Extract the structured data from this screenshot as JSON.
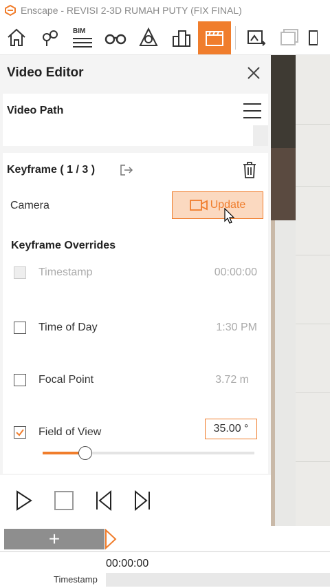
{
  "window": {
    "title": "Enscape - REVISI 2-3D RUMAH PUTY (FIX FINAL)"
  },
  "toolbar": {
    "bim_label": "BIM",
    "icons": [
      "home-icon",
      "location-pin-icon",
      "bim-icon",
      "binoculars-icon",
      "perspective-icon",
      "buildings-icon",
      "clapperboard-icon",
      "export-image-icon",
      "batch-export-icon",
      "export-icon"
    ]
  },
  "panel": {
    "title": "Video Editor",
    "video_path": {
      "title": "Video Path"
    },
    "keyframe": {
      "title": "Keyframe ( 1 / 3 )",
      "camera_label": "Camera",
      "update_label": "Update",
      "overrides_title": "Keyframe Overrides",
      "overrides": [
        {
          "label": "Timestamp",
          "value": "00:00:00",
          "checked": false,
          "disabled": true
        },
        {
          "label": "Time of Day",
          "value": "1:30 PM",
          "checked": false,
          "disabled": false
        },
        {
          "label": "Focal Point",
          "value": "3.72  m",
          "checked": false,
          "disabled": false
        },
        {
          "label": "Field of View",
          "value": "35.00  °",
          "checked": true,
          "disabled": false
        }
      ],
      "fov_slider_fraction": 0.2
    }
  },
  "timeline": {
    "add_label": "+",
    "time": "00:00:00",
    "row_label": "Timestamp"
  },
  "colors": {
    "accent": "#f07d2c",
    "accent_light": "#fbd9c0"
  }
}
